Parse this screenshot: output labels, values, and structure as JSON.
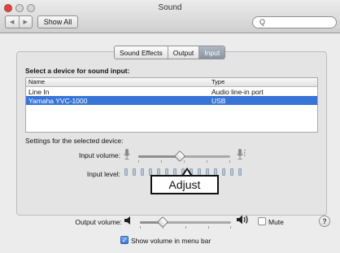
{
  "window": {
    "title": "Sound"
  },
  "toolbar": {
    "back_glyph": "◀",
    "forward_glyph": "▶",
    "show_all_label": "Show All",
    "search_glyph": "Q"
  },
  "tabs": [
    {
      "label": "Sound Effects",
      "active": false
    },
    {
      "label": "Output",
      "active": false
    },
    {
      "label": "Input",
      "active": true
    }
  ],
  "input": {
    "section_title": "Select a device for sound input:",
    "columns": [
      "Name",
      "Type"
    ],
    "devices": [
      {
        "name": "Line In",
        "type": "Audio line-in port",
        "selected": false
      },
      {
        "name": "Yamaha YVC-1000",
        "type": "USB",
        "selected": true
      }
    ],
    "settings_title": "Settings for the selected device:",
    "volume_label": "Input volume:",
    "volume_level": 0.45,
    "level_label": "Input level:",
    "level_segments": 15,
    "level_active": 0
  },
  "callout": {
    "text": "Adjust"
  },
  "output": {
    "volume_label": "Output volume:",
    "volume_level": 0.25,
    "mute_label": "Mute",
    "mute_checked": false,
    "show_in_menubar_label": "Show volume in menu bar",
    "show_in_menubar_checked": true
  },
  "help": {
    "glyph": "?"
  },
  "colors": {
    "selection": "#3874d8",
    "close": "#e0443e"
  }
}
